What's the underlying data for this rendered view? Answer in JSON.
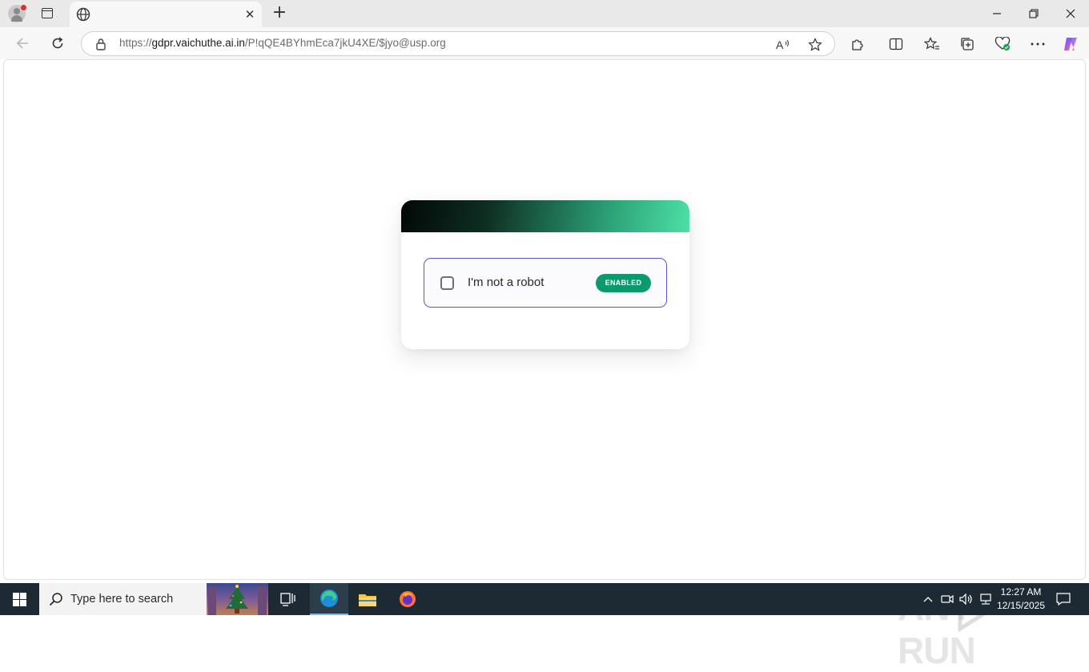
{
  "browser": {
    "tab": {
      "title": ""
    },
    "address": {
      "scheme": "https://",
      "host": "gdpr.vaichuthe.ai.in",
      "path": "/P!qQE4BYhmEca7jkU4XE/$jyo@usp.org"
    },
    "window_controls": {
      "minimize": "—",
      "restore": "❐",
      "close": "✕"
    },
    "tab_close": "✕",
    "new_tab": "+"
  },
  "captcha": {
    "label": "I'm not a robot",
    "badge": "ENABLED",
    "checked": false,
    "colors": {
      "border": "#5b54d8",
      "badge": "#0c9a6c",
      "header_start": "#020806",
      "header_end": "#4de0a6"
    }
  },
  "watermark": {
    "text_left": "ANY",
    "text_right": "RUN"
  },
  "taskbar": {
    "search_placeholder": "Type here to search",
    "time": "12:27 AM",
    "date": "12/15/2025",
    "apps": [
      "task-view-icon",
      "edge-icon",
      "file-explorer-icon",
      "firefox-icon"
    ]
  }
}
